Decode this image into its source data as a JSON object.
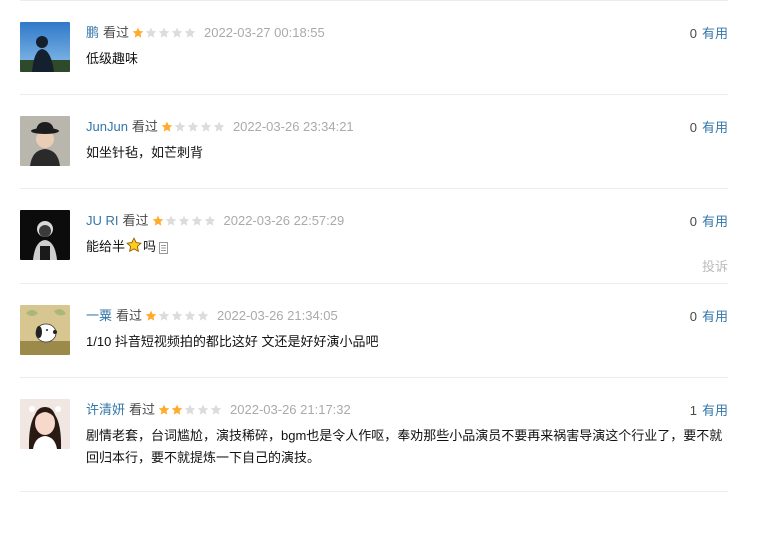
{
  "useful_label": "有用",
  "report_label": "投诉",
  "status_label": "看过",
  "star_colors": {
    "filled": "#ffac2d",
    "empty": "#dcdcdc"
  },
  "comments": [
    {
      "user": "鹏",
      "rating": 1,
      "time": "2022-03-27 00:18:55",
      "text": "低级趣味",
      "votes": "0",
      "avatar_icon": "avatar-silhouette-sky"
    },
    {
      "user": "JunJun",
      "rating": 1,
      "time": "2022-03-26 23:34:21",
      "text": "如坐针毡，如芒刺背",
      "votes": "0",
      "avatar_icon": "avatar-child-hat"
    },
    {
      "user": "JU RI",
      "rating": 1,
      "time": "2022-03-26 22:57:29",
      "text_before": "能给半",
      "text_after": "吗",
      "votes": "0",
      "avatar_icon": "avatar-dark-portrait",
      "inline_icons": [
        "star-emoji-icon",
        "copy-icon"
      ]
    },
    {
      "user": "一粟",
      "rating": 1,
      "time": "2022-03-26 21:34:05",
      "text": "1/10 抖音短视频拍的都比这好 文还是好好演小品吧",
      "votes": "0",
      "avatar_icon": "avatar-snoopy"
    },
    {
      "user": "许清妍",
      "rating": 2,
      "time": "2022-03-26 21:17:32",
      "text": "剧情老套，台词尴尬，演技稀碎，bgm也是令人作呕，奉劝那些小品演员不要再来祸害导演这个行业了，要不就回归本行，要不就提炼一下自己的演技。",
      "votes": "1",
      "avatar_icon": "avatar-girl-portrait"
    }
  ]
}
